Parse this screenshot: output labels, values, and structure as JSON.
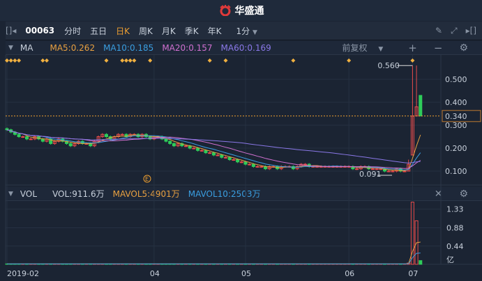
{
  "app": {
    "brand": "华盛通"
  },
  "toolbar": {
    "code": "00063",
    "tabs": [
      "分时",
      "五日",
      "日K",
      "周K",
      "月K",
      "季K",
      "年K"
    ],
    "active": "日K",
    "interval": "1分"
  },
  "ma_header": {
    "name": "MA",
    "ma5": "MA5:0.262",
    "ma10": "MA10:0.185",
    "ma20": "MA20:0.157",
    "ma60": "MA60:0.169",
    "adjust": "前复权"
  },
  "vol_header": {
    "name": "VOL",
    "vol": "VOL:911.6万",
    "mavol5": "MAVOL5:4901万",
    "mavol10": "MAVOL10:2503万"
  },
  "colors": {
    "up": "#e84b4b",
    "down": "#2ecc5a",
    "ma5": "#e8a040",
    "ma10": "#3a9ee0",
    "ma20": "#d070d0",
    "ma60": "#8a78e8",
    "accent": "#f0a030"
  },
  "chart_data": {
    "type": "candlestick",
    "price_ticks": [
      "0.500",
      "0.400",
      "0.300",
      "0.200",
      "0.100"
    ],
    "price_tick_values": [
      0.5,
      0.4,
      0.3,
      0.2,
      0.1
    ],
    "current_price": "0.340",
    "high_label": "0.560",
    "low_label": "0.091",
    "closes": [
      0.28,
      0.27,
      0.26,
      0.25,
      0.25,
      0.24,
      0.24,
      0.25,
      0.24,
      0.23,
      0.24,
      0.22,
      0.23,
      0.24,
      0.23,
      0.22,
      0.21,
      0.22,
      0.23,
      0.22,
      0.22,
      0.21,
      0.23,
      0.25,
      0.26,
      0.25,
      0.24,
      0.25,
      0.26,
      0.26,
      0.25,
      0.26,
      0.26,
      0.25,
      0.26,
      0.25,
      0.24,
      0.25,
      0.25,
      0.24,
      0.23,
      0.22,
      0.21,
      0.22,
      0.21,
      0.21,
      0.2,
      0.2,
      0.19,
      0.19,
      0.18,
      0.18,
      0.17,
      0.17,
      0.16,
      0.16,
      0.15,
      0.15,
      0.14,
      0.14,
      0.13,
      0.13,
      0.12,
      0.12,
      0.12,
      0.11,
      0.12,
      0.12,
      0.11,
      0.12,
      0.12,
      0.12,
      0.11,
      0.12,
      0.13,
      0.13,
      0.12,
      0.12,
      0.12,
      0.12,
      0.12,
      0.12,
      0.12,
      0.12,
      0.12,
      0.12,
      0.12,
      0.11,
      0.11,
      0.12,
      0.12,
      0.11,
      0.11,
      0.11,
      0.11,
      0.1,
      0.1,
      0.1,
      0.11,
      0.1,
      0.1
    ],
    "last_candles": [
      [
        0.1,
        0.15,
        0.1,
        0.13
      ],
      [
        0.17,
        0.56,
        0.17,
        0.34
      ],
      [
        0.34,
        0.56,
        0.34,
        0.38
      ],
      [
        0.43,
        0.43,
        0.34,
        0.34
      ]
    ],
    "volumes_yi": {
      "base": 0.01,
      "last": [
        0.03,
        1.5,
        1.05,
        0.09
      ]
    },
    "vol_ticks": [
      "1.33",
      "0.88",
      "0.44",
      "亿"
    ],
    "vol_tick_values": [
      1.33,
      0.88,
      0.44
    ],
    "event_markers": [
      0,
      1,
      2,
      3,
      9,
      10,
      25,
      29,
      30,
      31,
      32,
      36,
      51,
      55,
      72,
      86,
      102
    ],
    "x_labels": [
      {
        "i": 0,
        "t": "2019-02"
      },
      {
        "i": 37,
        "t": "04"
      },
      {
        "i": 60,
        "t": "05"
      },
      {
        "i": 86,
        "t": "06"
      },
      {
        "i": 102,
        "t": "07"
      }
    ],
    "annotation": "E"
  }
}
